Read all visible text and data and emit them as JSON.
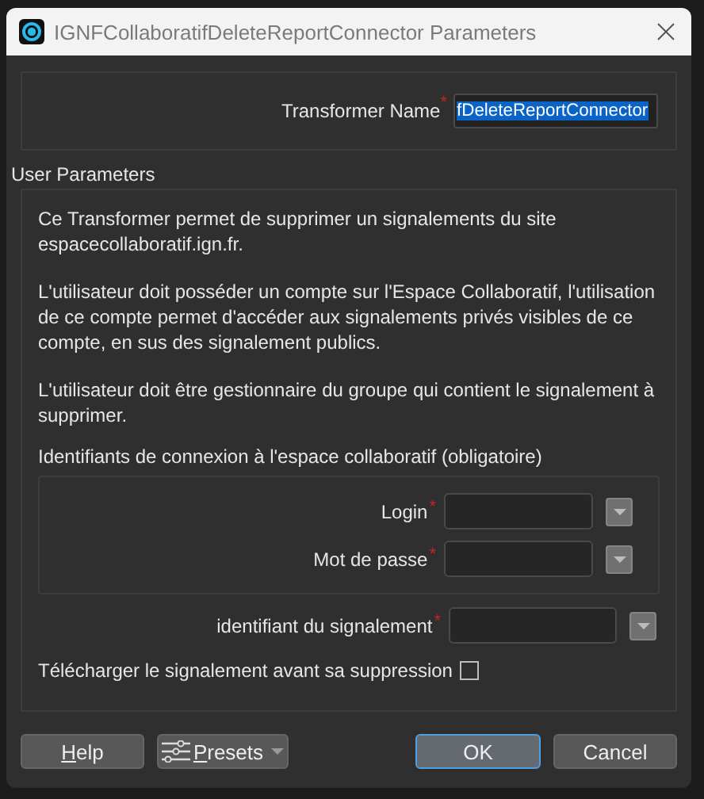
{
  "window": {
    "title": "IGNFCollaboratifDeleteReportConnector Parameters"
  },
  "transformer_name": {
    "label": "Transformer Name",
    "required_mark": "*",
    "value": "fDeleteReportConnector",
    "selected": true
  },
  "user_parameters": {
    "title": "User Parameters",
    "description": [
      "Ce Transformer permet de supprimer un signalements du site espacecollaboratif.ign.fr.",
      "L'utilisateur doit posséder un compte sur l'Espace Collaboratif, l'utilisation de ce compte permet d'accéder aux signalements privés visibles de ce compte, en sus des signalement publics.",
      "L'utilisateur doit être gestionnaire du groupe qui contient le signalement à supprimer."
    ],
    "parameters": [
      {
        "kind": "group",
        "label": "Identifiants de connexion à l'espace collaboratif (obligatoire)",
        "children": [
          {
            "kind": "text",
            "label": "Login",
            "required_mark": "*"
          },
          {
            "kind": "text",
            "label": "Mot de passe",
            "required_mark": "*"
          }
        ]
      },
      {
        "kind": "text",
        "label": "identifiant du signalement",
        "required_mark": "*"
      },
      {
        "kind": "checkbox",
        "label": "Télécharger le signalement avant sa suppression",
        "checked": false
      }
    ]
  },
  "buttons": [
    {
      "label": "Help",
      "kind": "plain"
    },
    {
      "label": "Presets",
      "kind": "menu"
    },
    {
      "label": "OK",
      "kind": "default"
    },
    {
      "label": "Cancel",
      "kind": "plain"
    }
  ]
}
